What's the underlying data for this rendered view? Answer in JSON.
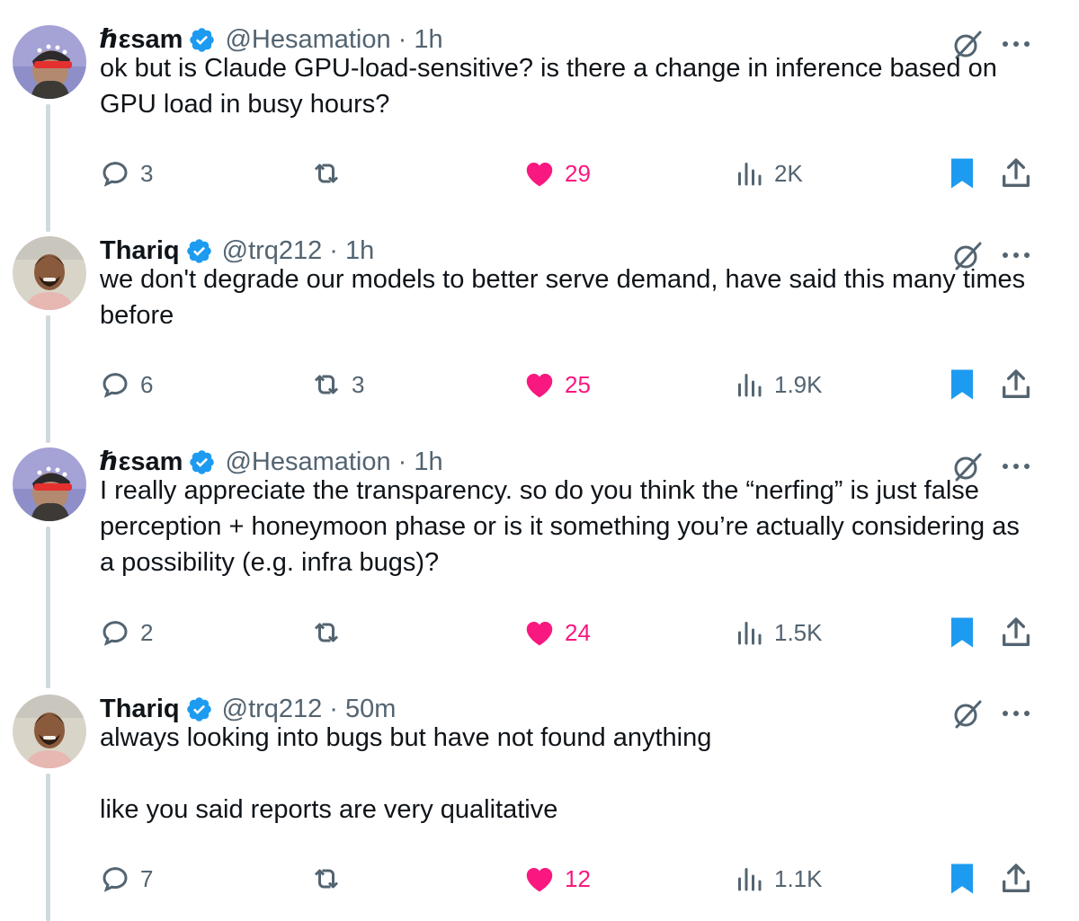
{
  "tweets": [
    {
      "name": "ℏεsam",
      "handle": "@Hesamation",
      "separator": "·",
      "time": "1h",
      "text": "ok but is Claude GPU-load-sensitive? is there a change in inference based on GPU load in busy hours?",
      "replies": "3",
      "reposts": "",
      "likes": "29",
      "views": "2K"
    },
    {
      "name": "Thariq",
      "handle": "@trq212",
      "separator": "·",
      "time": "1h",
      "text": "we don't degrade our models to better serve demand, have said this many times before",
      "replies": "6",
      "reposts": "3",
      "likes": "25",
      "views": "1.9K"
    },
    {
      "name": "ℏεsam",
      "handle": "@Hesamation",
      "separator": "·",
      "time": "1h",
      "text": "I really appreciate the transparency. so do you think the “nerfing” is just false perception + honeymoon phase or is it something you’re actually considering as a possibility (e.g. infra bugs)?",
      "replies": "2",
      "reposts": "",
      "likes": "24",
      "views": "1.5K"
    },
    {
      "name": "Thariq",
      "handle": "@trq212",
      "separator": "·",
      "time": "50m",
      "text": "always looking into bugs but have not found anything\n\nlike you said reports are very qualitative",
      "replies": "7",
      "reposts": "",
      "likes": "12",
      "views": "1.1K"
    }
  ],
  "icons": {
    "verified": "verified-badge-icon",
    "grok": "grok-icon",
    "more": "more-icon",
    "reply": "reply-icon",
    "repost": "repost-icon",
    "like": "heart-icon",
    "views": "views-icon",
    "bookmark": "bookmark-icon",
    "share": "share-icon"
  },
  "colors": {
    "verified": "#1d9bf0",
    "like": "#f91880",
    "bookmark": "#1d9bf0",
    "secondary_text": "#536471",
    "thread_line": "#cfd9de"
  }
}
